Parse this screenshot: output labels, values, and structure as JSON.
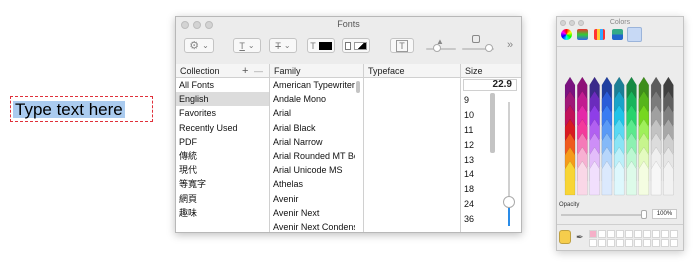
{
  "textbox": {
    "text": "Type text here"
  },
  "fonts_window": {
    "title": "Fonts",
    "toolbar": {
      "text_color_swatch": "#000000",
      "doc_color_swatch": "#000000"
    },
    "columns": {
      "collection": "Collection",
      "add": "+",
      "remove": "—",
      "family": "Family",
      "typeface": "Typeface",
      "size": "Size"
    },
    "collections": [
      "All Fonts",
      "English",
      "Favorites",
      "Recently Used",
      "PDF",
      "傳統",
      "現代",
      "等寬字",
      "網頁",
      "趣味"
    ],
    "selected_collection": "English",
    "families": [
      "American Typewriter",
      "Andale Mono",
      "Arial",
      "Arial Black",
      "Arial Narrow",
      "Arial Rounded MT Bold",
      "Arial Unicode MS",
      "Athelas",
      "Avenir",
      "Avenir Next",
      "Avenir Next Condensed"
    ],
    "size_value": "22.9",
    "sizes": [
      "9",
      "10",
      "11",
      "12",
      "13",
      "14",
      "18",
      "24",
      "36"
    ],
    "size_slider_level": 0.3
  },
  "colors_window": {
    "title": "Colors",
    "opacity_label": "Opacity",
    "opacity_value": "100%",
    "opacity_level": 1.0,
    "current_color": "#f6cd4c",
    "crayon_colors": [
      "#7a1280",
      "#8e1178",
      "#3b2a8a",
      "#1f3fa0",
      "#1b7f96",
      "#178a44",
      "#3e8e1b",
      "#5c5c5c",
      "#404040",
      "#a01878",
      "#c21b90",
      "#6b2bbd",
      "#2a5cd8",
      "#1aa3c9",
      "#17b55b",
      "#56b51c",
      "#7b7b7b",
      "#5f5f5f",
      "#c0125a",
      "#e42aa8",
      "#8e3ee8",
      "#3a7cf2",
      "#20c3e8",
      "#27d36c",
      "#76d720",
      "#a0a0a0",
      "#808080",
      "#d81a22",
      "#f33a9b",
      "#b160f1",
      "#5a9af6",
      "#5ad8f3",
      "#5be98d",
      "#9ff05a",
      "#c3c3c3",
      "#a8a8a8",
      "#ef5a1e",
      "#f57ab8",
      "#cd8ef7",
      "#85b9f8",
      "#8ae4f6",
      "#8cf1b1",
      "#c7f58e",
      "#dcdcdc",
      "#cfcfcf",
      "#f59b1a",
      "#f7b0d2",
      "#e3bdfa",
      "#b7d6fb",
      "#bcf0fa",
      "#bcf8d2",
      "#e4fbc0",
      "#efefef",
      "#e6e6e6",
      "#f8d535",
      "#fad7e7",
      "#f1dffd",
      "#dbe9fd",
      "#def8fd",
      "#ddfbe9",
      "#f4fde1",
      "#f7f7f7",
      "#f2f2f2"
    ]
  }
}
